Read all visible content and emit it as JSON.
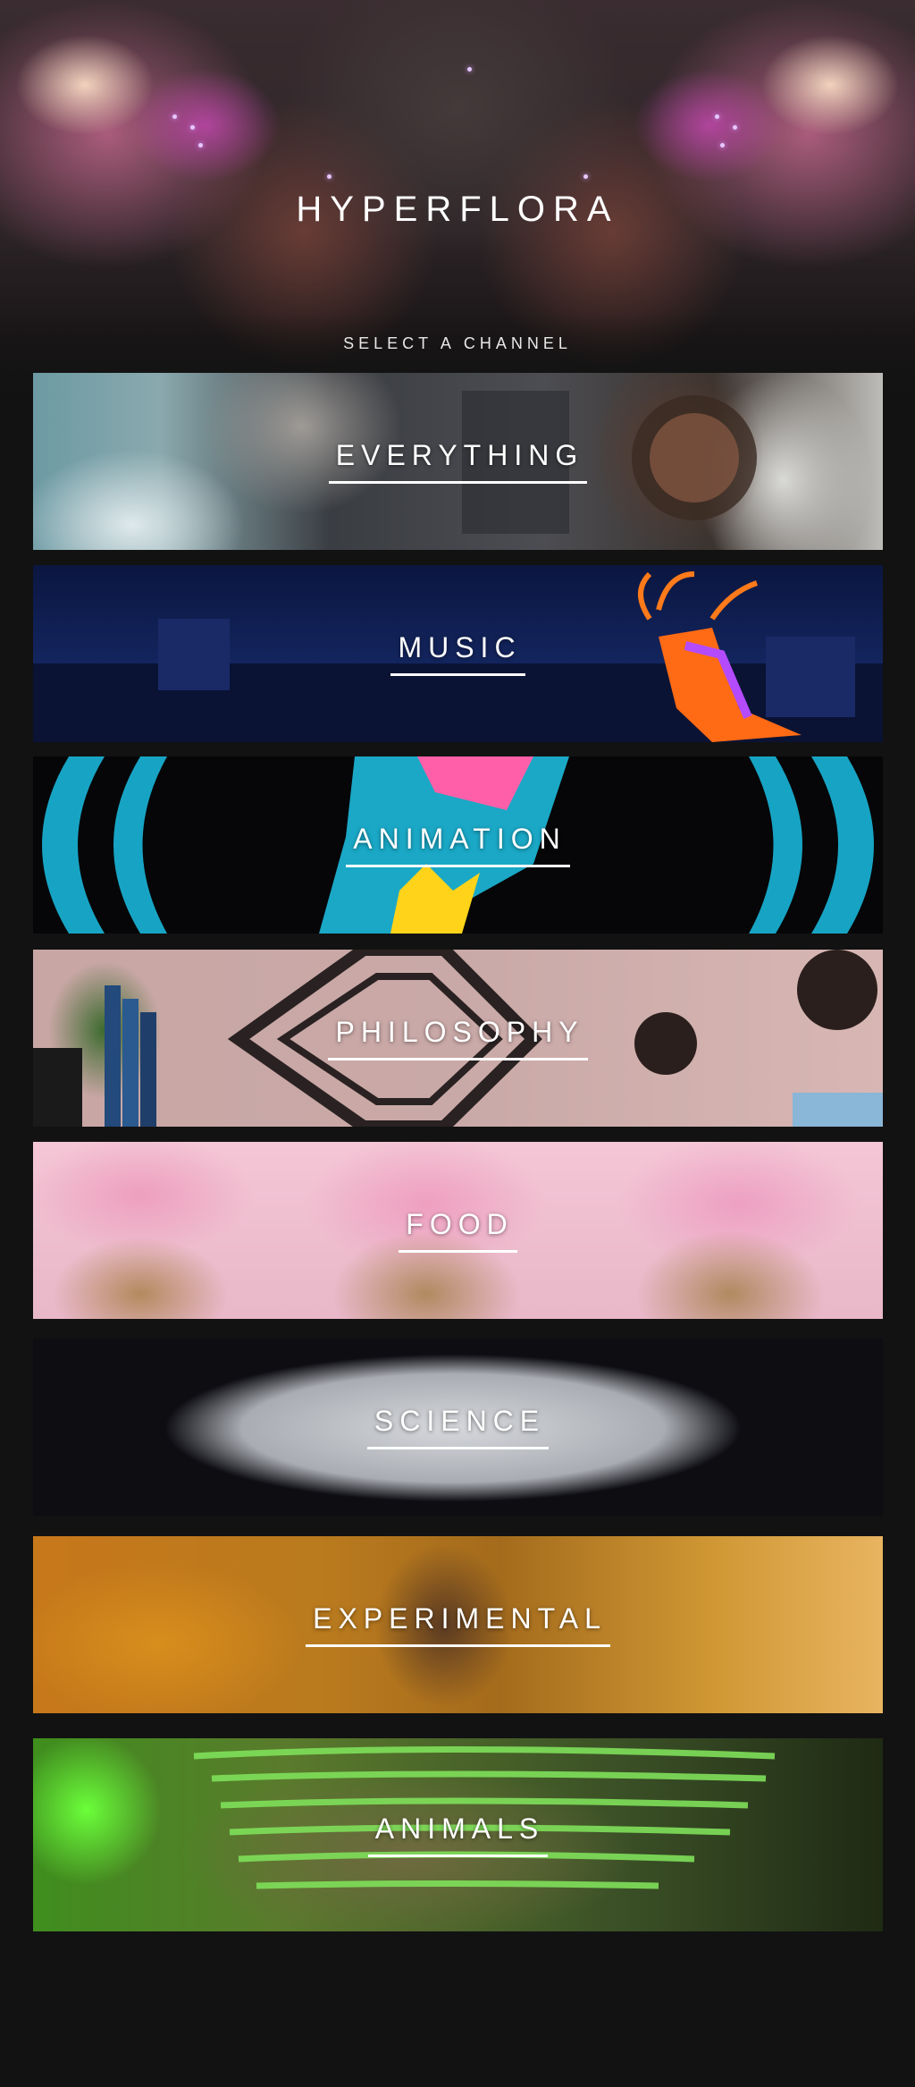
{
  "site": {
    "title": "HYPERFLORA",
    "subtitle": "SELECT A CHANNEL"
  },
  "channels": [
    {
      "label": "EVERYTHING"
    },
    {
      "label": "MUSIC"
    },
    {
      "label": "ANIMATION"
    },
    {
      "label": "PHILOSOPHY"
    },
    {
      "label": "FOOD"
    },
    {
      "label": "SCIENCE"
    },
    {
      "label": "EXPERIMENTAL"
    },
    {
      "label": "ANIMALS"
    }
  ]
}
